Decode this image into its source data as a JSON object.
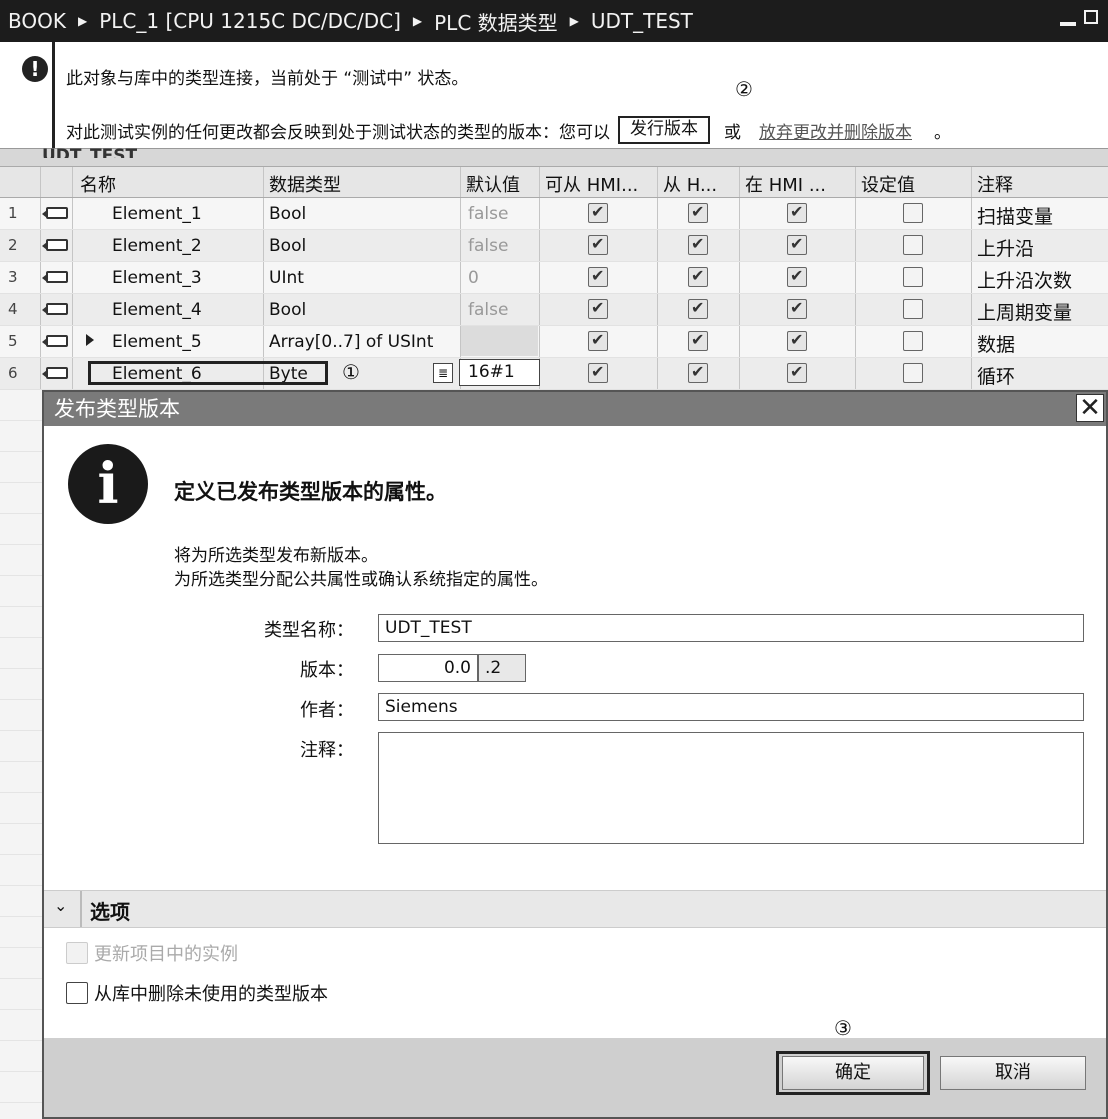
{
  "titlebar": {
    "crumbs": [
      "BOOK",
      "PLC_1 [CPU 1215C DC/DC/DC]",
      "PLC 数据类型",
      "UDT_TEST"
    ]
  },
  "infobar": {
    "message1": "此对象与库中的类型连接，当前处于 “测试中” 状态。",
    "message2_prefix": "对此测试实例的任何更改都会反映到处于测试状态的类型的版本：您可以",
    "publish_label": "发行版本",
    "or_text": "或",
    "discard_label": "放弃更改并删除版本",
    "period": "。",
    "marker": "②"
  },
  "editor": {
    "udt_name": "UDT_TEST"
  },
  "table": {
    "headers": {
      "name": "名称",
      "datatype": "数据类型",
      "default": "默认值",
      "hmi_access": "可从 HMI...",
      "from_hmi": "从 H...",
      "in_hmi": "在 HMI ...",
      "setpoint": "设定值",
      "comment": "注释"
    },
    "rows": [
      {
        "num": "1",
        "name": "Element_1",
        "type": "Bool",
        "default": "false",
        "hmi": true,
        "from": true,
        "inhmi": true,
        "setpoint": false,
        "comment": "扫描变量"
      },
      {
        "num": "2",
        "name": "Element_2",
        "type": "Bool",
        "default": "false",
        "hmi": true,
        "from": true,
        "inhmi": true,
        "setpoint": false,
        "comment": "上升沿"
      },
      {
        "num": "3",
        "name": "Element_3",
        "type": "UInt",
        "default": "0",
        "hmi": true,
        "from": true,
        "inhmi": true,
        "setpoint": false,
        "comment": "上升沿次数"
      },
      {
        "num": "4",
        "name": "Element_4",
        "type": "Bool",
        "default": "false",
        "hmi": true,
        "from": true,
        "inhmi": true,
        "setpoint": false,
        "comment": "上周期变量"
      },
      {
        "num": "5",
        "name": "Element_5",
        "type": "Array[0..7] of USInt",
        "default": "",
        "hmi": true,
        "from": true,
        "inhmi": true,
        "setpoint": false,
        "comment": "数据"
      },
      {
        "num": "6",
        "name": "Element_6",
        "type": "Byte",
        "default": "16#1",
        "hmi": true,
        "from": true,
        "inhmi": true,
        "setpoint": false,
        "comment": "循环"
      }
    ],
    "row6_marker": "①"
  },
  "dialog": {
    "title": "发布类型版本",
    "close_glyph": "✕",
    "info_glyph": "i",
    "headline": "定义已发布类型版本的属性。",
    "desc1": "将为所选类型发布新版本。",
    "desc2": "为所选类型分配公共属性或确认系统指定的属性。",
    "type_name_label": "类型名称：",
    "type_name_value": "UDT_TEST",
    "version_label": "版本：",
    "version_major": "0.0",
    "version_minor": ".2",
    "author_label": "作者：",
    "author_value": "Siemens",
    "comment_label": "注释：",
    "comment_value": "",
    "options_label": "选项",
    "opt_update": "更新项目中的实例",
    "opt_delete": "从库中删除未使用的类型版本",
    "ok_label": "确定",
    "cancel_label": "取消",
    "ok_marker": "③"
  }
}
